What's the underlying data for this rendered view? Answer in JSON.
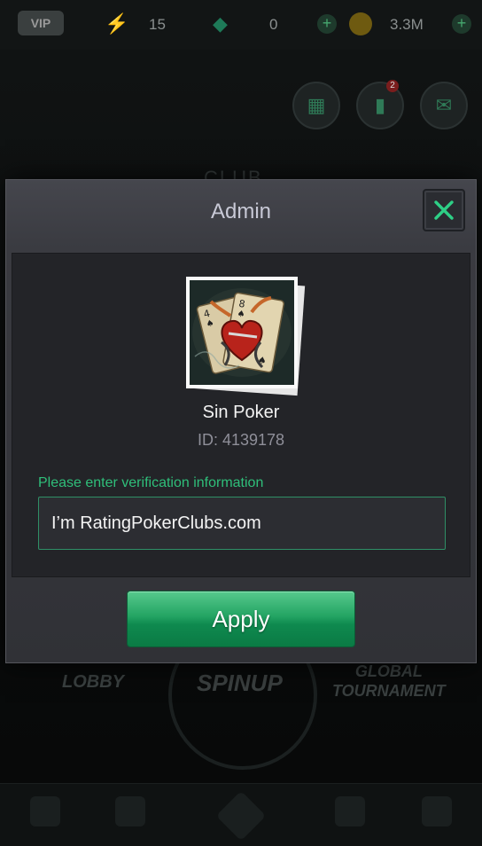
{
  "status_bar": {
    "vip_label": "VIP",
    "energy_count": "15",
    "gem_count": "0",
    "coin_count": "3.3M"
  },
  "background": {
    "club_label": "CLUB",
    "lobby_label": "LOBBY",
    "spinup_label": "SPINUP",
    "global_tournament_label": "GLOBAL\nTOURNAMENT",
    "mail_badge_count": "2"
  },
  "modal": {
    "title": "Admin",
    "club_name": "Sin Poker",
    "club_id": "ID: 4139178",
    "verify_label": "Please enter verification information",
    "verify_value": "I’m RatingPokerClubs.com",
    "apply_label": "Apply"
  },
  "colors": {
    "accent_green": "#2fbf7a",
    "button_green": "#0f8a4f",
    "modal_bg": "#3a3b41"
  },
  "icons": [
    "energy-icon",
    "gem-icon",
    "coin-icon",
    "calendar-icon",
    "ranking-icon",
    "mail-icon",
    "close-icon",
    "club-avatar"
  ]
}
